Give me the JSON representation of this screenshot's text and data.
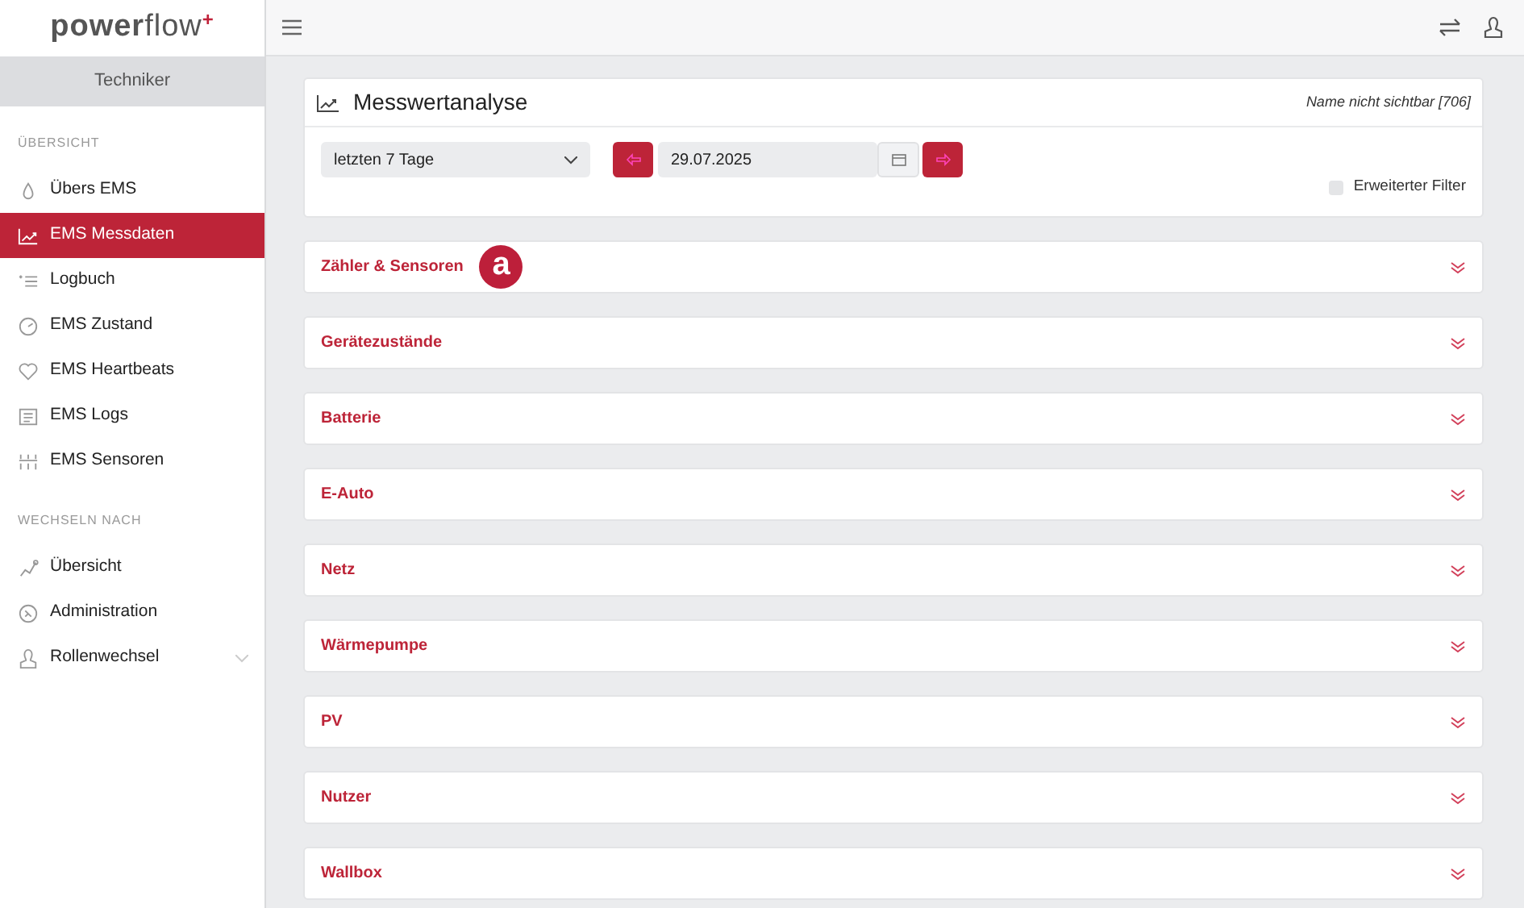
{
  "logo": {
    "text": "powerflow",
    "mark": "+"
  },
  "role": "Techniker",
  "sidebar": {
    "sections": [
      {
        "heading": "ÜBERSICHT",
        "items": [
          {
            "label": "Übers EMS",
            "selected": false
          },
          {
            "label": "EMS Messdaten",
            "selected": true
          },
          {
            "label": "Logbuch",
            "selected": false
          },
          {
            "label": "EMS Zustand",
            "selected": false
          },
          {
            "label": "EMS Heartbeats",
            "selected": false
          },
          {
            "label": "EMS Logs",
            "selected": false
          },
          {
            "label": "EMS Sensoren",
            "selected": false
          }
        ]
      },
      {
        "heading": "WECHSELN NACH",
        "items": [
          {
            "label": "Übersicht",
            "selected": false
          },
          {
            "label": "Administration",
            "selected": false
          },
          {
            "label": "Rollenwechsel",
            "selected": false,
            "expandable": true
          }
        ]
      }
    ]
  },
  "panel": {
    "title": "Messwertanalyse",
    "name_note": "Name nicht sichtbar [706]",
    "range": "letzten 7 Tage",
    "date": "29.07.2025",
    "extended_filter": {
      "label": "Erweiterter Filter",
      "checked": false
    }
  },
  "sections": [
    {
      "title": "Zähler & Sensoren",
      "marker": "a"
    },
    {
      "title": "Gerätezustände"
    },
    {
      "title": "Batterie"
    },
    {
      "title": "E-Auto"
    },
    {
      "title": "Netz"
    },
    {
      "title": "Wärmepumpe"
    },
    {
      "title": "PV"
    },
    {
      "title": "Nutzer"
    },
    {
      "title": "Wallbox"
    }
  ]
}
